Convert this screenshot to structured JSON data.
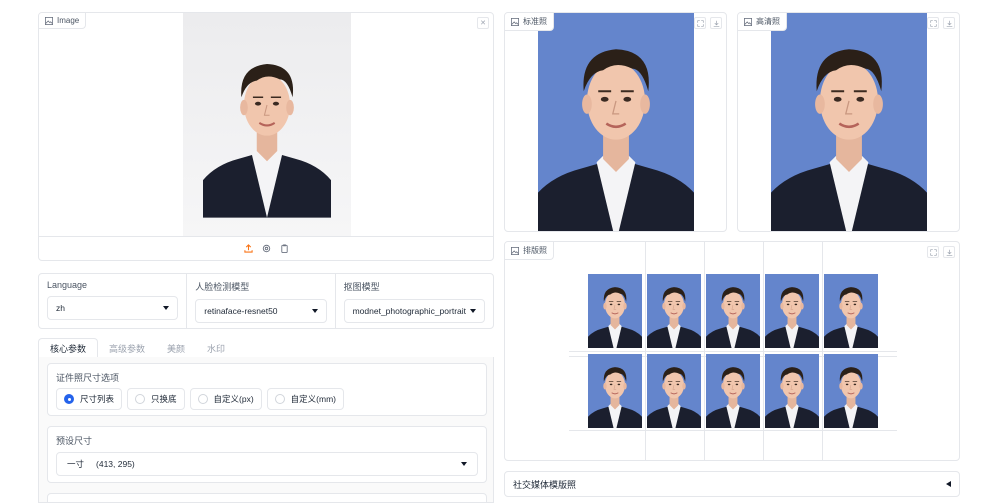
{
  "input": {
    "label": "Image",
    "icon": "image-icon",
    "close_icon": "close-icon",
    "toolbar_icons": [
      "upload-icon",
      "webcam-icon",
      "clipboard-icon"
    ]
  },
  "dropdowns": [
    {
      "label": "Language",
      "value": "zh"
    },
    {
      "label": "人脸检测模型",
      "value": "retinaface-resnet50"
    },
    {
      "label": "抠图模型",
      "value": "modnet_photographic_portrait"
    }
  ],
  "tabs": [
    "核心参数",
    "高级参数",
    "美颜",
    "水印"
  ],
  "active_tab": "核心参数",
  "size_option": {
    "label": "证件照尺寸选项",
    "options": [
      "尺寸列表",
      "只换底",
      "自定义(px)",
      "自定义(mm)"
    ],
    "selected": "尺寸列表"
  },
  "preset": {
    "label": "预设尺寸",
    "name": "一寸",
    "dims": "(413, 295)"
  },
  "outputs": {
    "standard_label": "标准照",
    "hd_label": "高清照",
    "layout_label": "排版照"
  },
  "social": {
    "label": "社交媒体模版照"
  },
  "colors": {
    "photo_bg": "#6485cc",
    "accent": "#2563eb",
    "upload": "#f97316"
  }
}
